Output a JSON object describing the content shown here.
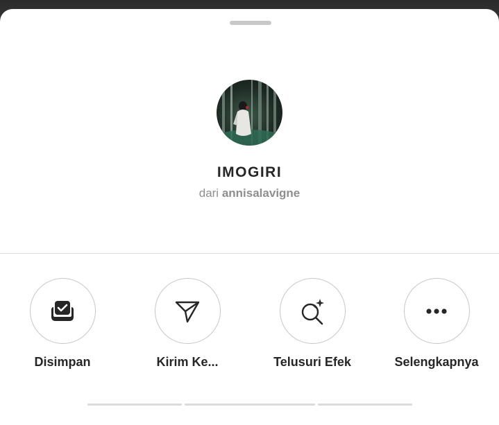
{
  "effect": {
    "name": "IMOGIRI",
    "author_prefix": "dari",
    "author": "annisalavigne"
  },
  "actions": [
    {
      "label": "Disimpan",
      "icon": "saved-check-icon"
    },
    {
      "label": "Kirim Ke...",
      "icon": "send-icon"
    },
    {
      "label": "Telusuri Efek",
      "icon": "browse-effects-icon"
    },
    {
      "label": "Selengkapnya",
      "icon": "more-icon"
    }
  ],
  "colors": {
    "text": "#262626",
    "secondary_text": "#8e8e8e",
    "border": "#c7c7c7",
    "divider": "#dbdbdb"
  }
}
